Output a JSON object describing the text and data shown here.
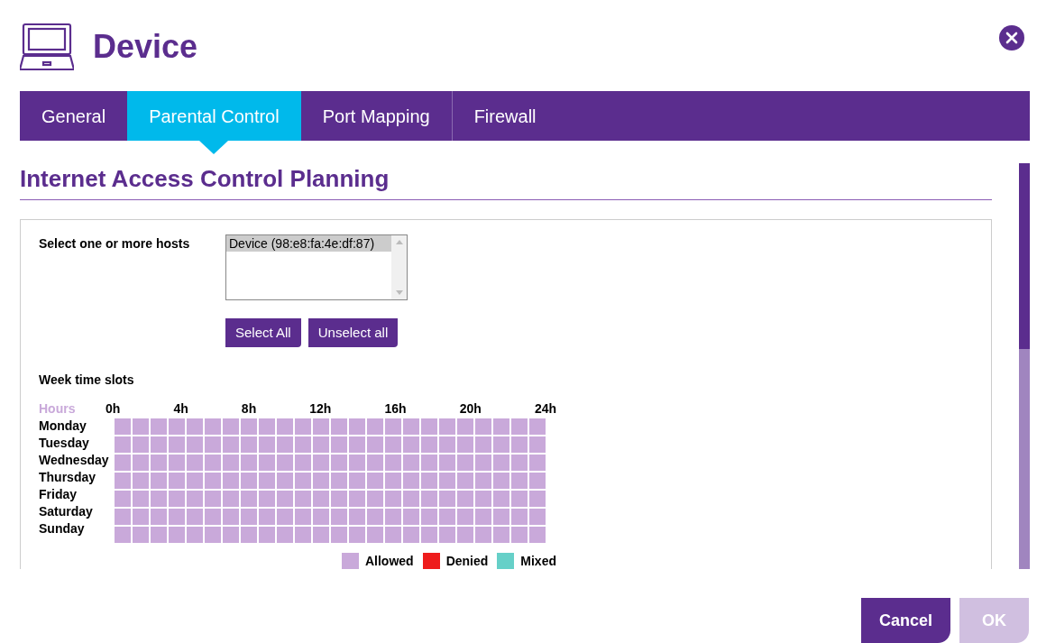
{
  "dialog": {
    "title": "Device"
  },
  "tabs": [
    {
      "label": "General",
      "selected": false
    },
    {
      "label": "Parental Control",
      "selected": true
    },
    {
      "label": "Port Mapping",
      "selected": false
    },
    {
      "label": "Firewall",
      "selected": false
    }
  ],
  "section": {
    "title": "Internet Access Control Planning"
  },
  "hosts": {
    "label": "Select one or more hosts",
    "options": [
      {
        "label": "Device (98:e8:fa:4e:df:87)",
        "selected": true
      }
    ],
    "buttons": [
      "Select All",
      "Unselect all"
    ]
  },
  "schedule": {
    "label": "Week time slots",
    "corner": "Hours",
    "hours": [
      "0h",
      "4h",
      "8h",
      "12h",
      "16h",
      "20h",
      "24h"
    ],
    "days": [
      {
        "name": "Monday",
        "slots": [
          {
            "kind": "allowed"
          },
          {
            "kind": "allowed"
          },
          {
            "kind": "allowed"
          },
          {
            "kind": "allowed"
          },
          {
            "kind": "allowed"
          },
          {
            "kind": "allowed"
          },
          {
            "kind": "allowed"
          },
          {
            "kind": "allowed"
          },
          {
            "kind": "allowed"
          },
          {
            "kind": "allowed"
          },
          {
            "kind": "allowed"
          },
          {
            "kind": "allowed"
          },
          {
            "kind": "allowed"
          },
          {
            "kind": "allowed"
          },
          {
            "kind": "allowed"
          },
          {
            "kind": "allowed"
          },
          {
            "kind": "allowed"
          },
          {
            "kind": "allowed"
          },
          {
            "kind": "allowed"
          },
          {
            "kind": "allowed"
          },
          {
            "kind": "allowed"
          },
          {
            "kind": "allowed"
          },
          {
            "kind": "allowed"
          },
          {
            "kind": "allowed"
          }
        ]
      },
      {
        "name": "Tuesday",
        "slots": [
          {
            "kind": "allowed"
          },
          {
            "kind": "allowed"
          },
          {
            "kind": "allowed"
          },
          {
            "kind": "allowed"
          },
          {
            "kind": "allowed"
          },
          {
            "kind": "allowed"
          },
          {
            "kind": "allowed"
          },
          {
            "kind": "allowed"
          },
          {
            "kind": "allowed"
          },
          {
            "kind": "allowed"
          },
          {
            "kind": "allowed"
          },
          {
            "kind": "allowed"
          },
          {
            "kind": "allowed"
          },
          {
            "kind": "allowed"
          },
          {
            "kind": "allowed"
          },
          {
            "kind": "allowed"
          },
          {
            "kind": "allowed"
          },
          {
            "kind": "allowed"
          },
          {
            "kind": "allowed"
          },
          {
            "kind": "allowed"
          },
          {
            "kind": "allowed"
          },
          {
            "kind": "allowed"
          },
          {
            "kind": "allowed"
          },
          {
            "kind": "allowed"
          }
        ]
      },
      {
        "name": "Wednesday",
        "slots": [
          {
            "kind": "allowed"
          },
          {
            "kind": "allowed"
          },
          {
            "kind": "allowed"
          },
          {
            "kind": "allowed"
          },
          {
            "kind": "allowed"
          },
          {
            "kind": "allowed"
          },
          {
            "kind": "allowed"
          },
          {
            "kind": "allowed"
          },
          {
            "kind": "allowed"
          },
          {
            "kind": "allowed"
          },
          {
            "kind": "allowed"
          },
          {
            "kind": "allowed"
          },
          {
            "kind": "allowed"
          },
          {
            "kind": "allowed"
          },
          {
            "kind": "allowed"
          },
          {
            "kind": "allowed"
          },
          {
            "kind": "allowed"
          },
          {
            "kind": "allowed"
          },
          {
            "kind": "allowed"
          },
          {
            "kind": "allowed"
          },
          {
            "kind": "allowed"
          },
          {
            "kind": "allowed"
          },
          {
            "kind": "allowed"
          },
          {
            "kind": "allowed"
          }
        ]
      },
      {
        "name": "Thursday",
        "slots": [
          {
            "kind": "allowed"
          },
          {
            "kind": "allowed"
          },
          {
            "kind": "allowed"
          },
          {
            "kind": "allowed"
          },
          {
            "kind": "allowed"
          },
          {
            "kind": "allowed"
          },
          {
            "kind": "allowed"
          },
          {
            "kind": "allowed"
          },
          {
            "kind": "allowed"
          },
          {
            "kind": "allowed"
          },
          {
            "kind": "allowed"
          },
          {
            "kind": "allowed"
          },
          {
            "kind": "allowed"
          },
          {
            "kind": "allowed"
          },
          {
            "kind": "allowed"
          },
          {
            "kind": "allowed"
          },
          {
            "kind": "allowed"
          },
          {
            "kind": "allowed"
          },
          {
            "kind": "allowed"
          },
          {
            "kind": "allowed"
          },
          {
            "kind": "allowed"
          },
          {
            "kind": "allowed"
          },
          {
            "kind": "allowed"
          },
          {
            "kind": "allowed"
          }
        ]
      },
      {
        "name": "Friday",
        "slots": [
          {
            "kind": "allowed"
          },
          {
            "kind": "allowed"
          },
          {
            "kind": "allowed"
          },
          {
            "kind": "allowed"
          },
          {
            "kind": "allowed"
          },
          {
            "kind": "allowed"
          },
          {
            "kind": "allowed"
          },
          {
            "kind": "allowed"
          },
          {
            "kind": "allowed"
          },
          {
            "kind": "allowed"
          },
          {
            "kind": "allowed"
          },
          {
            "kind": "allowed"
          },
          {
            "kind": "allowed"
          },
          {
            "kind": "allowed"
          },
          {
            "kind": "allowed"
          },
          {
            "kind": "allowed"
          },
          {
            "kind": "allowed"
          },
          {
            "kind": "allowed"
          },
          {
            "kind": "allowed"
          },
          {
            "kind": "allowed"
          },
          {
            "kind": "allowed"
          },
          {
            "kind": "allowed"
          },
          {
            "kind": "allowed"
          },
          {
            "kind": "allowed"
          }
        ]
      },
      {
        "name": "Saturday",
        "slots": [
          {
            "kind": "allowed"
          },
          {
            "kind": "allowed"
          },
          {
            "kind": "allowed"
          },
          {
            "kind": "allowed"
          },
          {
            "kind": "allowed"
          },
          {
            "kind": "allowed"
          },
          {
            "kind": "allowed"
          },
          {
            "kind": "allowed"
          },
          {
            "kind": "allowed"
          },
          {
            "kind": "allowed"
          },
          {
            "kind": "allowed"
          },
          {
            "kind": "allowed"
          },
          {
            "kind": "allowed"
          },
          {
            "kind": "allowed"
          },
          {
            "kind": "allowed"
          },
          {
            "kind": "allowed"
          },
          {
            "kind": "allowed"
          },
          {
            "kind": "allowed"
          },
          {
            "kind": "allowed"
          },
          {
            "kind": "allowed"
          },
          {
            "kind": "allowed"
          },
          {
            "kind": "allowed"
          },
          {
            "kind": "allowed"
          },
          {
            "kind": "allowed"
          }
        ]
      },
      {
        "name": "Sunday",
        "slots": [
          {
            "kind": "allowed"
          },
          {
            "kind": "allowed"
          },
          {
            "kind": "allowed"
          },
          {
            "kind": "allowed"
          },
          {
            "kind": "allowed"
          },
          {
            "kind": "allowed"
          },
          {
            "kind": "allowed"
          },
          {
            "kind": "allowed"
          },
          {
            "kind": "allowed"
          },
          {
            "kind": "allowed"
          },
          {
            "kind": "allowed"
          },
          {
            "kind": "allowed"
          },
          {
            "kind": "allowed"
          },
          {
            "kind": "allowed"
          },
          {
            "kind": "allowed"
          },
          {
            "kind": "allowed"
          },
          {
            "kind": "allowed"
          },
          {
            "kind": "allowed"
          },
          {
            "kind": "allowed"
          },
          {
            "kind": "allowed"
          },
          {
            "kind": "allowed"
          },
          {
            "kind": "allowed"
          },
          {
            "kind": "allowed"
          },
          {
            "kind": "allowed"
          }
        ]
      }
    ],
    "legend": [
      {
        "label": "Allowed",
        "color": "#c9a9da"
      },
      {
        "label": "Denied",
        "color": "#ee1c1c"
      },
      {
        "label": "Mixed",
        "color": "#66d0c8"
      }
    ]
  },
  "footer": {
    "buttons": [
      {
        "label": "Cancel",
        "disabled": false
      },
      {
        "label": "OK",
        "disabled": true
      }
    ]
  }
}
